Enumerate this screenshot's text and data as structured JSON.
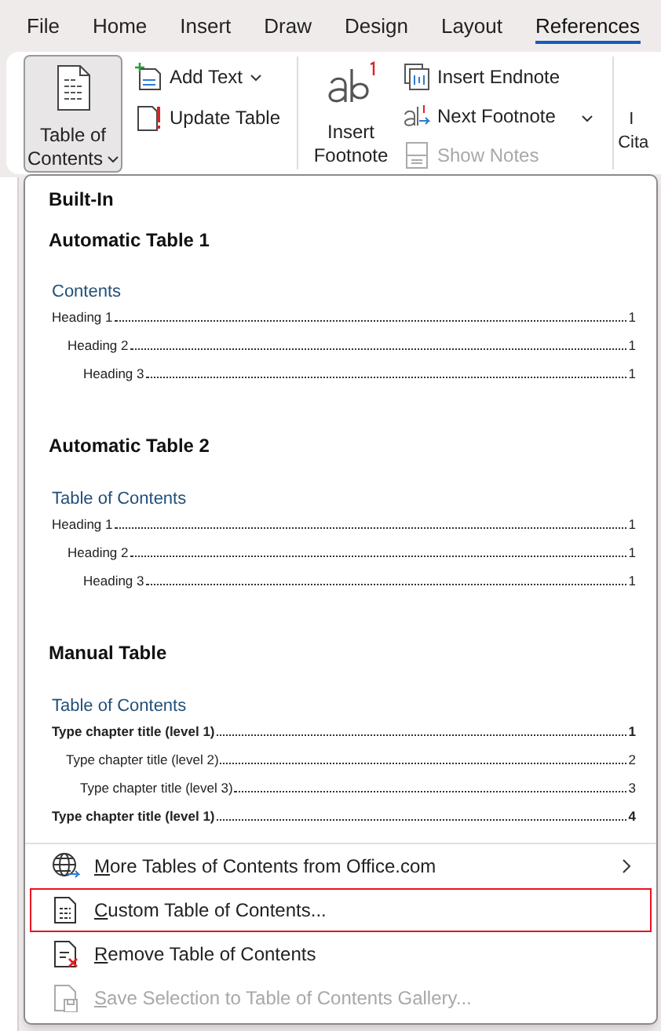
{
  "tabs": [
    {
      "label": "File",
      "selected": false
    },
    {
      "label": "Home",
      "selected": false
    },
    {
      "label": "Insert",
      "selected": false
    },
    {
      "label": "Draw",
      "selected": false
    },
    {
      "label": "Design",
      "selected": false
    },
    {
      "label": "Layout",
      "selected": false
    },
    {
      "label": "References",
      "selected": true
    }
  ],
  "ribbon": {
    "toc_button": {
      "label_lines": [
        "Table of",
        "Contents"
      ],
      "selected": true
    },
    "toc_small": [
      {
        "kind": "add",
        "label": "Add Text",
        "dropdown": true
      },
      {
        "kind": "update",
        "label": "Update Table",
        "dropdown": false
      }
    ],
    "footnote_button": {
      "label_lines": [
        "Insert",
        "Footnote"
      ]
    },
    "footnote_small": [
      {
        "kind": "endnote",
        "label": "Insert Endnote",
        "disabled": false
      },
      {
        "kind": "next",
        "label": "Next Footnote",
        "disabled": false
      },
      {
        "kind": "notes",
        "label": "Show Notes",
        "disabled": true
      }
    ],
    "cut_button": {
      "label_lines": [
        "I",
        "Cita"
      ]
    }
  },
  "dropdown": {
    "header": "Built-In",
    "sections": [
      {
        "title": "Automatic Table 1",
        "toc_title": "Contents",
        "entries": [
          {
            "text": "Heading 1",
            "page": "1",
            "bold": false,
            "children": [
              {
                "text": "Heading 2",
                "page": "1",
                "bold": false,
                "children": [
                  {
                    "text": "Heading 3",
                    "page": "1",
                    "bold": false
                  }
                ]
              }
            ]
          }
        ]
      },
      {
        "title": "Automatic Table 2",
        "toc_title": "Table of Contents",
        "entries": [
          {
            "text": "Heading 1",
            "page": "1",
            "bold": false,
            "children": [
              {
                "text": "Heading 2",
                "page": "1",
                "bold": false,
                "children": [
                  {
                    "text": "Heading 3",
                    "page": "1",
                    "bold": false
                  }
                ]
              }
            ]
          }
        ]
      },
      {
        "title": "Manual Table",
        "toc_title": "Table of Contents",
        "entries": [
          {
            "text": "Type chapter title (level 1)",
            "page": "1",
            "bold": true,
            "children": [
              {
                "text": "Type chapter title (level 2)",
                "page": "2",
                "bold": false,
                "children": [
                  {
                    "text": "Type chapter title (level 3)",
                    "page": "3",
                    "bold": false
                  }
                ]
              }
            ]
          },
          {
            "text": "Type chapter title (level 1)",
            "page": "4",
            "bold": true
          }
        ]
      }
    ],
    "menu": [
      {
        "kind": "globe",
        "label": "More Tables of Contents from Office.com",
        "submenu": true,
        "highlighted": false,
        "disabled": false
      },
      {
        "kind": "custom",
        "label": "Custom Table of Contents...",
        "submenu": false,
        "highlighted": true,
        "disabled": false
      },
      {
        "kind": "remove",
        "label": "Remove Table of Contents",
        "submenu": false,
        "highlighted": false,
        "disabled": false
      },
      {
        "kind": "save",
        "label": "Save Selection to Table of Contents Gallery...",
        "submenu": false,
        "highlighted": false,
        "disabled": true
      }
    ]
  }
}
